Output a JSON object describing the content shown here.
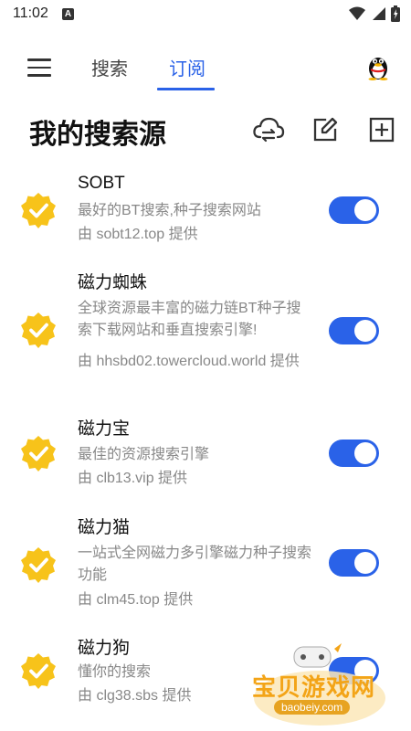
{
  "status": {
    "time": "11:02",
    "notif": "A"
  },
  "nav": {
    "tabs": [
      {
        "label": "搜索"
      },
      {
        "label": "订阅"
      }
    ],
    "active_tab": "订阅"
  },
  "header": {
    "title": "我的搜索源",
    "icons": [
      "cloud-sync-icon",
      "edit-icon",
      "add-icon"
    ]
  },
  "sources": [
    {
      "name": "SOBT",
      "desc": "最好的BT搜索,种子搜索网站",
      "by": "由 sobt12.top 提供",
      "enabled": true
    },
    {
      "name": "磁力蜘蛛",
      "desc": "全球资源最丰富的磁力链BT种子搜索下载网站和垂直搜索引擎!",
      "by": "由 hhsbd02.towercloud.world 提供",
      "enabled": true
    },
    {
      "name": "磁力宝",
      "desc": "最佳的资源搜索引擎",
      "by": "由 clb13.vip 提供",
      "enabled": true
    },
    {
      "name": "磁力猫",
      "desc": "一站式全网磁力多引擎磁力种子搜索功能",
      "by": "由 clm45.top 提供",
      "enabled": true
    },
    {
      "name": "磁力狗",
      "desc": "懂你的搜索",
      "by": "由 clg38.sbs 提供",
      "enabled": true
    }
  ],
  "watermark": {
    "text": "宝贝游戏网",
    "url": "baobeiy.com"
  },
  "colors": {
    "accent": "#2a62e8",
    "badge": "#f7c31a"
  }
}
